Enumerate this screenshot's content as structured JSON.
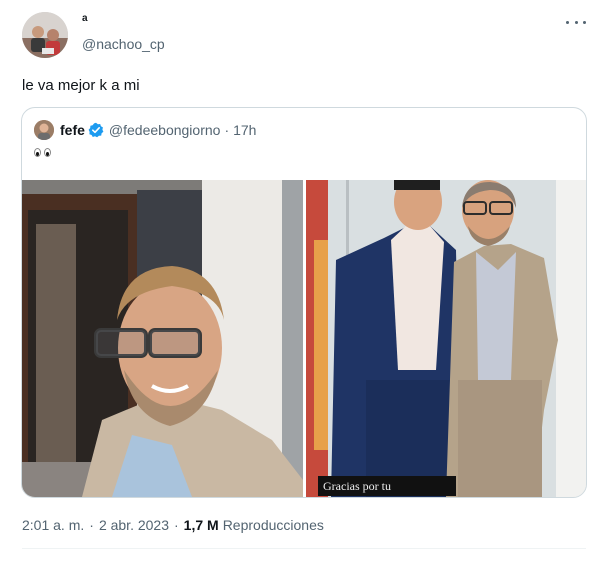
{
  "tweet": {
    "display_name": "a",
    "handle": "@nachoo_cp",
    "text": "le va mejor k a mi",
    "more_icon": "more-horizontal-icon"
  },
  "quote": {
    "name": "fefe",
    "verified_icon": "verified-badge-icon",
    "handle": "@fedeebongiorno",
    "separator": "·",
    "time": "17h",
    "emoji_icon": "eyes-emoji-icon",
    "photo_caption": "Gracias por tu"
  },
  "meta": {
    "time": "2:01 a. m.",
    "separator": "·",
    "date": "2 abr. 2023",
    "separator2": "·",
    "views_count": "1,7 M",
    "views_label": "Reproducciones"
  },
  "colors": {
    "text_primary": "#0f1419",
    "text_secondary": "#536471",
    "border": "#cfd9de",
    "verified": "#1d9bf0"
  }
}
